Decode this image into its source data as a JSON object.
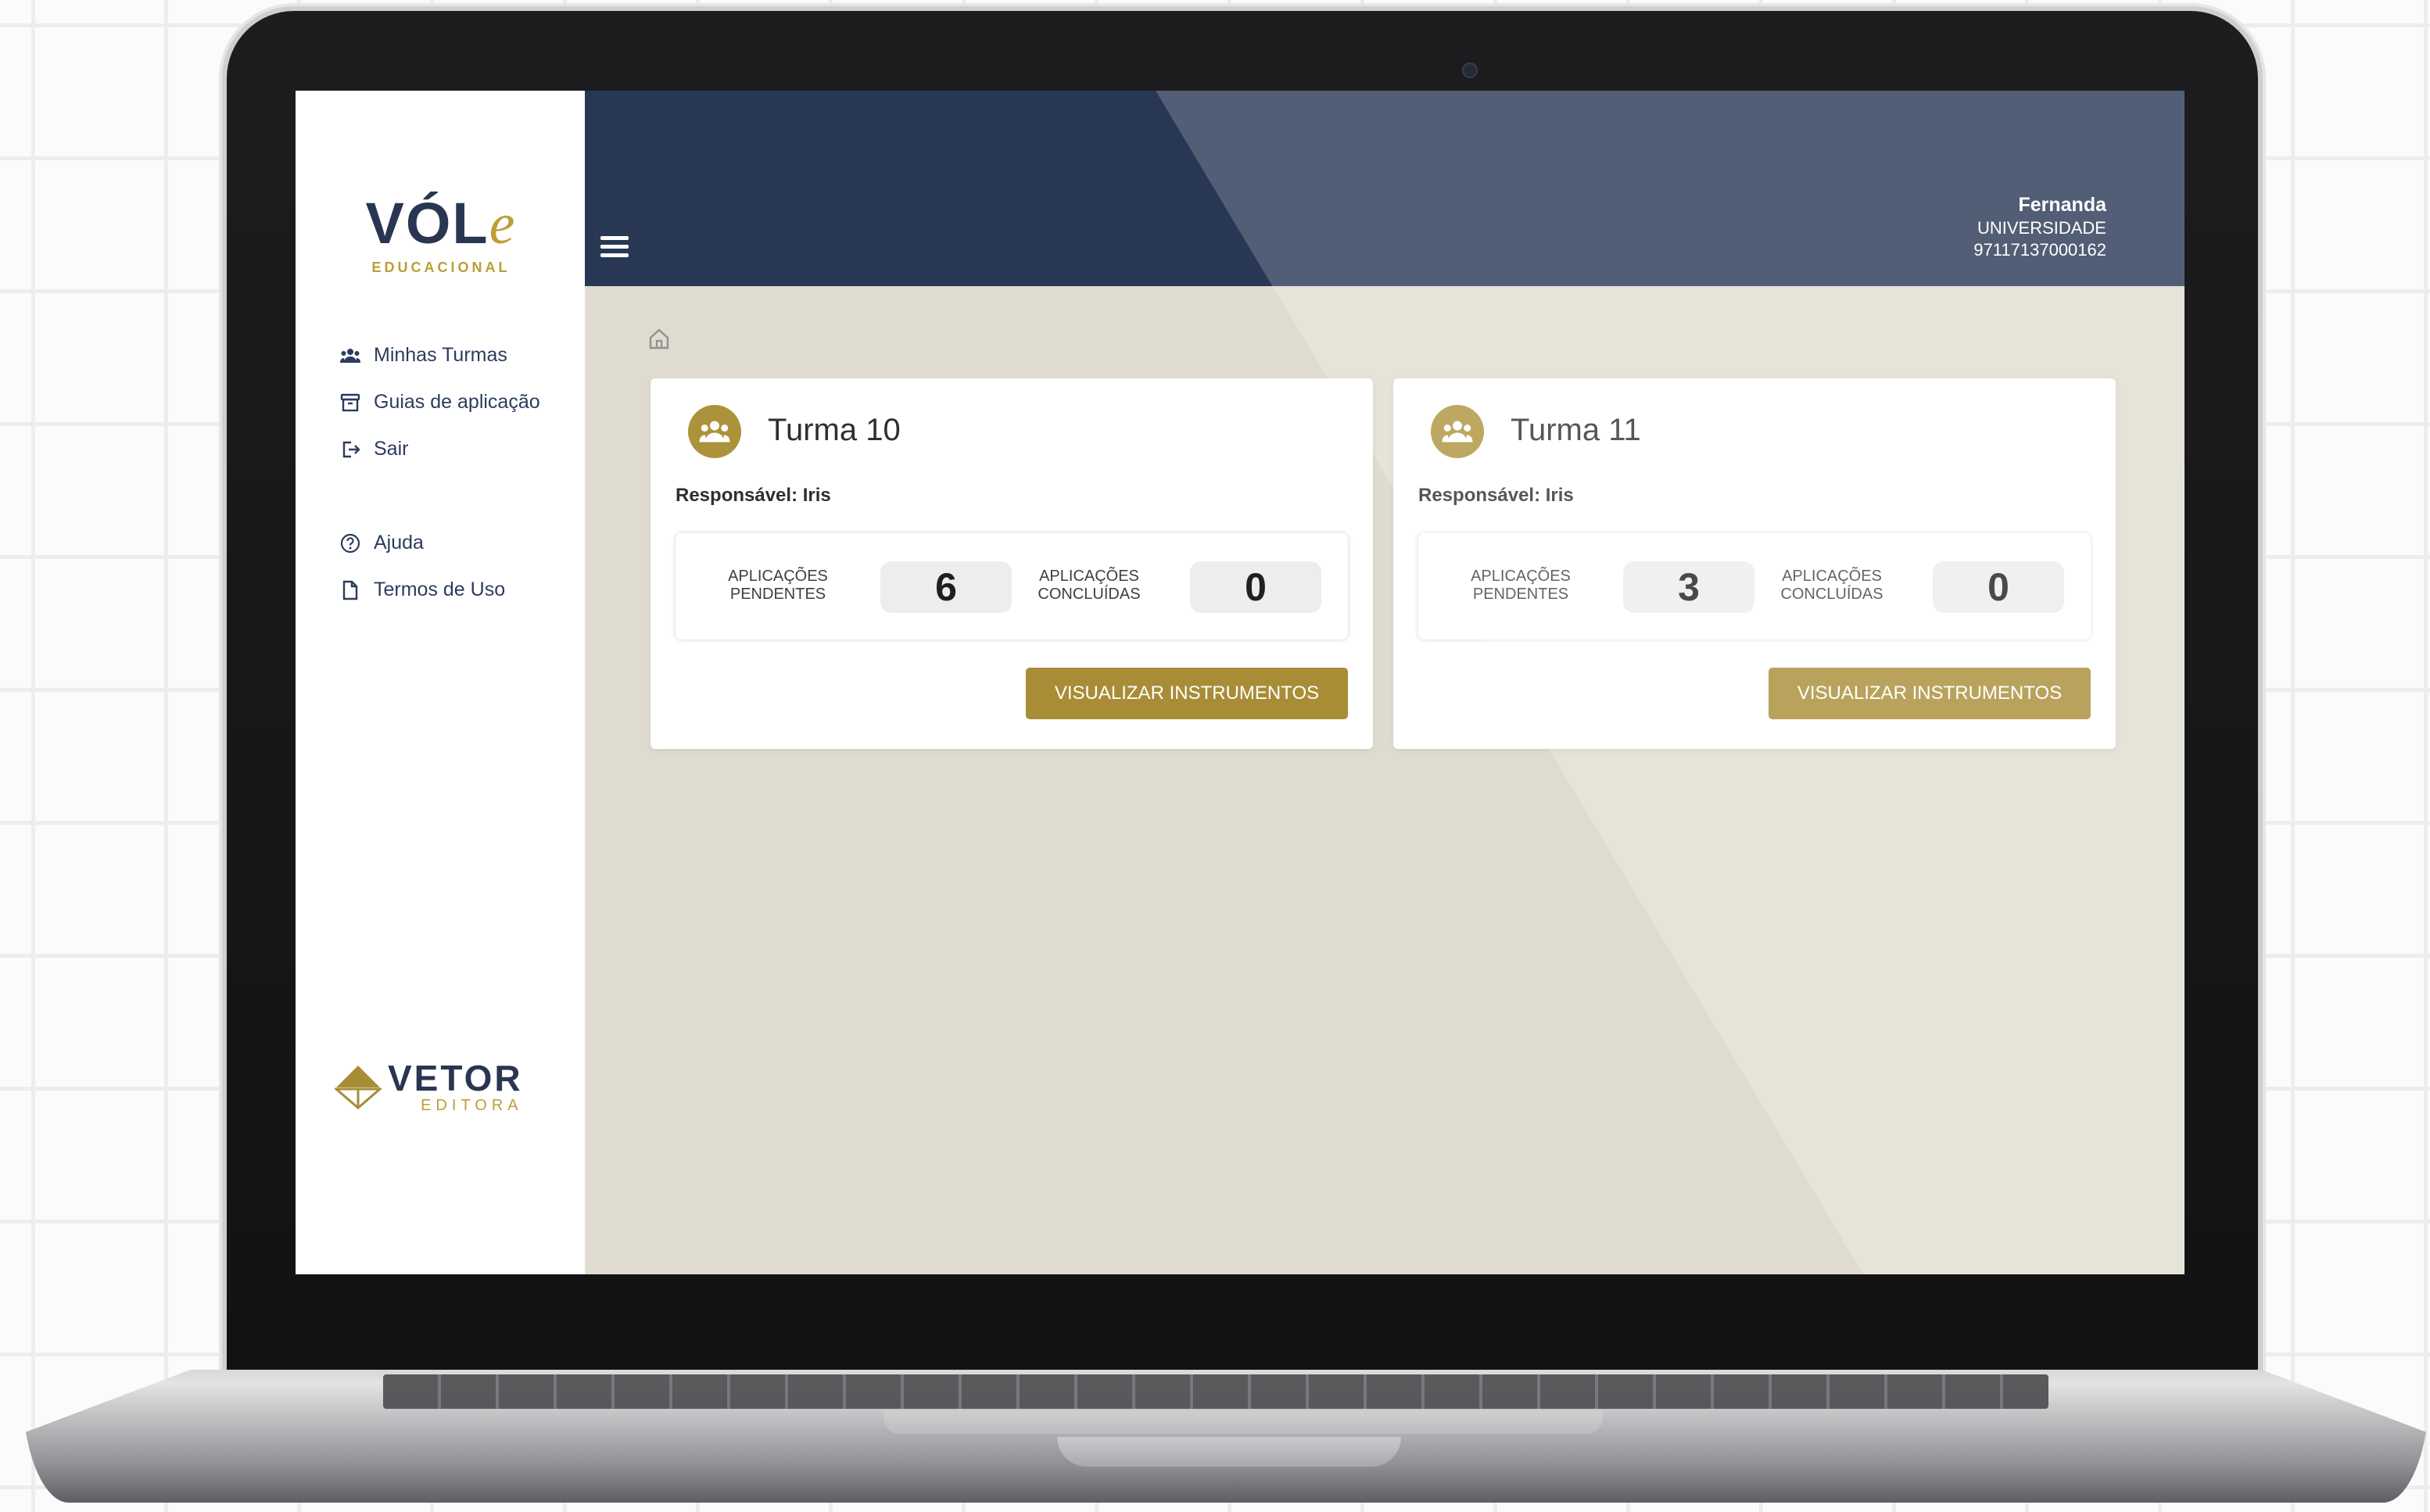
{
  "brand": {
    "logo_main": "VÓL",
    "logo_accent": "e",
    "logo_sub": "EDUCACIONAL"
  },
  "sidebar": {
    "items": [
      {
        "label": "Minhas Turmas",
        "icon": "group-icon"
      },
      {
        "label": "Guias de aplicação",
        "icon": "archive-icon"
      },
      {
        "label": "Sair",
        "icon": "logout-icon"
      },
      {
        "label": "Ajuda",
        "icon": "help-circle-icon"
      },
      {
        "label": "Termos de Uso",
        "icon": "document-icon"
      }
    ],
    "footer_logo": {
      "main": "VETOR",
      "sub": "EDITORA"
    }
  },
  "header": {
    "user_name": "Fernanda",
    "user_org": "UNIVERSIDADE",
    "user_id": "97117137000162"
  },
  "classes": [
    {
      "title": "Turma 10",
      "responsible": "Responsável: Iris",
      "pending_label_1": "APLICAÇÕES",
      "pending_label_2": "PENDENTES",
      "pending": "6",
      "done_label_1": "APLICAÇÕES",
      "done_label_2": "CONCLUÍDAS",
      "done": "0",
      "button": "VISUALIZAR INSTRUMENTOS"
    },
    {
      "title": "Turma 11",
      "responsible": "Responsável: Iris",
      "pending_label_1": "APLICAÇÕES",
      "pending_label_2": "PENDENTES",
      "pending": "3",
      "done_label_1": "APLICAÇÕES",
      "done_label_2": "CONCLUÍDAS",
      "done": "0",
      "button": "VISUALIZAR INSTRUMENTOS"
    }
  ],
  "colors": {
    "navy": "#1b2c4a",
    "gold": "#a3862a",
    "content_bg": "#dedacd"
  }
}
